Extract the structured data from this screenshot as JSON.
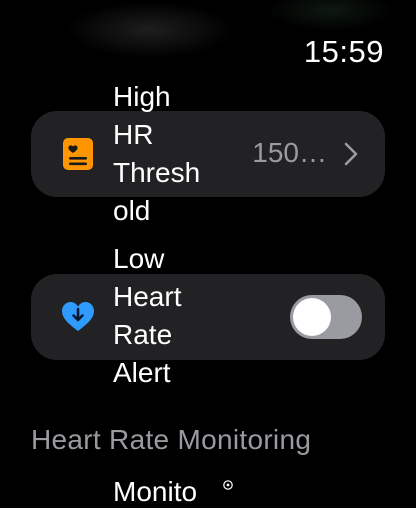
{
  "status": {
    "time": "15:59"
  },
  "settings": {
    "high_threshold": {
      "label": "High\nHR\nThresh\nold",
      "value": "150…",
      "icon": "heart-chart-icon",
      "icon_color": "#FF9500"
    },
    "low_alert": {
      "label": "Low\nHeart\nRate\nAlert",
      "icon": "heart-down-arrow-icon",
      "icon_color": "#2F9BFF",
      "toggle_on": false
    }
  },
  "section": {
    "title": "Heart Rate Monitoring",
    "next_item_partial": "Monito"
  }
}
